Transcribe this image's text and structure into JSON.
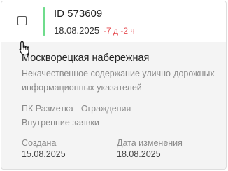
{
  "card": {
    "id_label": "ID 573609",
    "date": "18.08.2025",
    "overdue": "-7 д -2 ч",
    "street": "Москворецкая набережная",
    "description": "Некачественное содержание улично-дорожных информационных указателей",
    "contractor": "ПК Разметка - Ограждения",
    "source": "Внутренние заявки",
    "created_label": "Создана",
    "created_date": "15.08.2025",
    "modified_label": "Дата изменения",
    "modified_date": "18.08.2025"
  },
  "colors": {
    "accent": "#6fdc8c",
    "overdue": "#e5484d"
  }
}
